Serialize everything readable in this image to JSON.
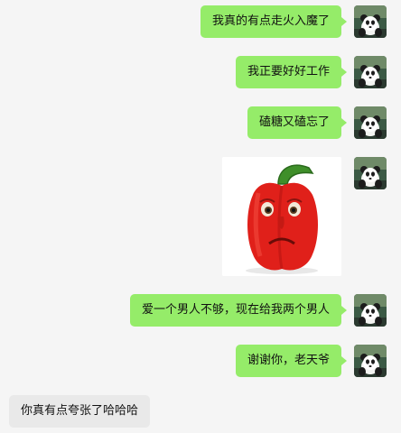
{
  "messages": [
    {
      "sender": "self",
      "type": "text",
      "text": "我真的有点走火入魔了"
    },
    {
      "sender": "self",
      "type": "text",
      "text": "我正要好好工作"
    },
    {
      "sender": "self",
      "type": "text",
      "text": "磕糖又磕忘了"
    },
    {
      "sender": "self",
      "type": "image",
      "image": "red-bell-pepper-face-sticker"
    },
    {
      "sender": "self",
      "type": "text",
      "text": "爱一个男人不够，现在给我两个男人"
    },
    {
      "sender": "self",
      "type": "text",
      "text": "谢谢你，老天爷"
    },
    {
      "sender": "other",
      "type": "text",
      "text": "你真有点夸张了哈哈哈"
    }
  ],
  "avatar_icon": "panda-avatar",
  "colors": {
    "background": "#f5f5f5",
    "self_bubble": "#95ec69",
    "other_bubble": "#e9e9e9",
    "text": "#111111"
  }
}
